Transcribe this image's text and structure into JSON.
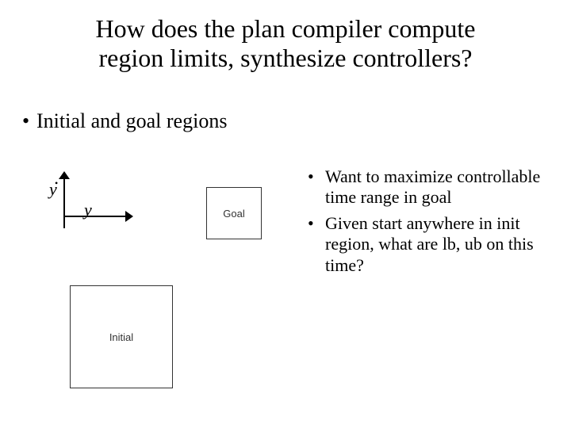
{
  "title_line1": "How does the plan compiler compute",
  "title_line2": "region limits, synthesize controllers?",
  "main_bullet": "Initial and goal regions",
  "right_bullets": [
    "Want to maximize controllable time range in goal",
    "Given start anywhere in init region, what are lb, ub on this time?"
  ],
  "axis": {
    "y_label": "y",
    "y_dot": "•",
    "x_label": "y"
  },
  "goal_label": "Goal",
  "initial_label": "Initial"
}
